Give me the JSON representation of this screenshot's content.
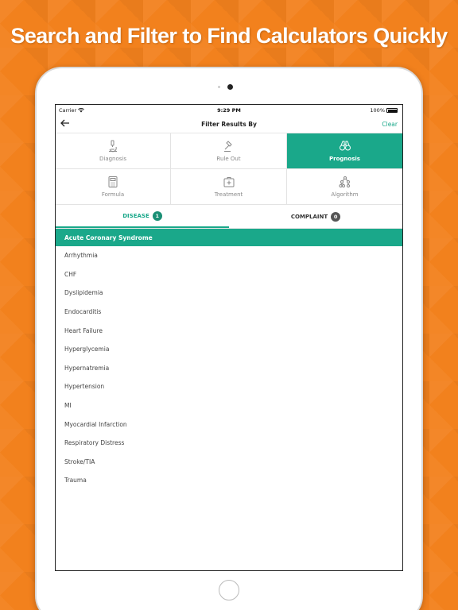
{
  "headline": "Search and Filter to Find Calculators Quickly",
  "status_bar": {
    "carrier": "Carrier",
    "time": "9:29 PM",
    "battery": "100%"
  },
  "nav": {
    "back_icon": "arrow-left-icon",
    "title": "Filter Results By",
    "clear_label": "Clear"
  },
  "filters": [
    {
      "label": "Diagnosis",
      "icon": "microscope-icon",
      "active": false
    },
    {
      "label": "Rule Out",
      "icon": "gavel-icon",
      "active": false
    },
    {
      "label": "Prognosis",
      "icon": "binoculars-icon",
      "active": true
    },
    {
      "label": "Formula",
      "icon": "calculator-icon",
      "active": false
    },
    {
      "label": "Treatment",
      "icon": "medkit-icon",
      "active": false
    },
    {
      "label": "Algorithm",
      "icon": "flowchart-icon",
      "active": false
    }
  ],
  "tabs": [
    {
      "label": "DISEASE",
      "count": "1",
      "active": true
    },
    {
      "label": "COMPLAINT",
      "count": "0",
      "active": false
    }
  ],
  "diseases": [
    {
      "label": "Acute Coronary Syndrome",
      "selected": true
    },
    {
      "label": "Arrhythmia",
      "selected": false
    },
    {
      "label": "CHF",
      "selected": false
    },
    {
      "label": "Dyslipidemia",
      "selected": false
    },
    {
      "label": "Endocarditis",
      "selected": false
    },
    {
      "label": "Heart Failure",
      "selected": false
    },
    {
      "label": "Hyperglycemia",
      "selected": false
    },
    {
      "label": "Hypernatremia",
      "selected": false
    },
    {
      "label": "Hypertension",
      "selected": false
    },
    {
      "label": "MI",
      "selected": false
    },
    {
      "label": "Myocardial Infarction",
      "selected": false
    },
    {
      "label": "Respiratory Distress",
      "selected": false
    },
    {
      "label": "Stroke/TIA",
      "selected": false
    },
    {
      "label": "Trauma",
      "selected": false
    }
  ],
  "colors": {
    "background": "#f2811d",
    "accent": "#1aa88a"
  }
}
